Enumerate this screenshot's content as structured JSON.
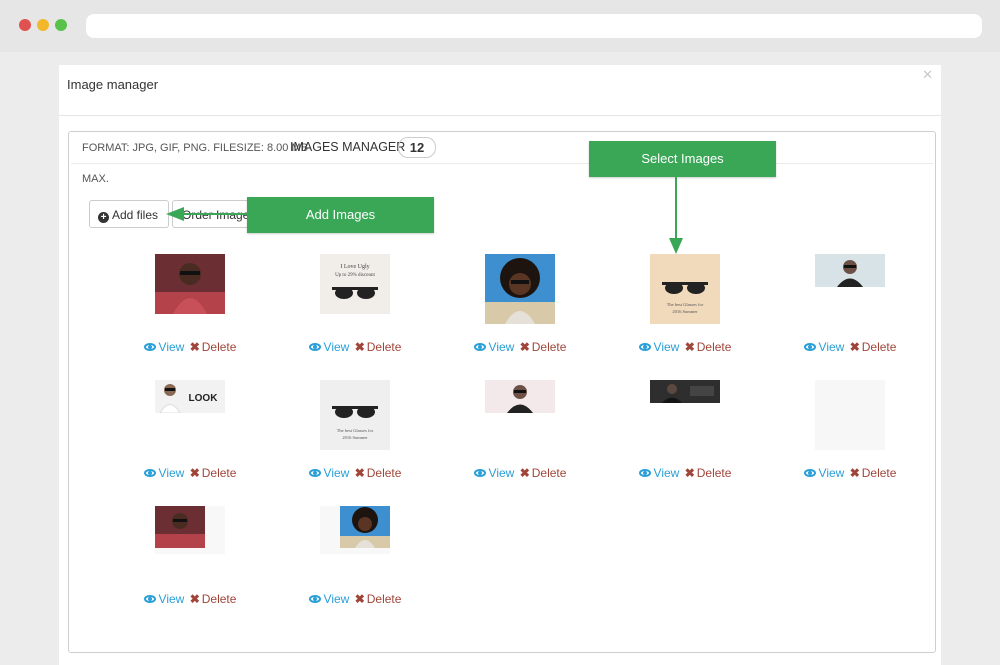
{
  "window": {
    "title": "Image manager"
  },
  "panel": {
    "format_text": "FORMAT: JPG, GIF, PNG. FILESIZE: 8.00 MB",
    "max_text": "MAX.",
    "manager_label": "IMAGES MANAGER",
    "image_count": "12"
  },
  "toolbar": {
    "add_files_label": "Add files",
    "order_images_label": "Order Images"
  },
  "actions": {
    "view_label": "View",
    "delete_label": "Delete"
  },
  "callouts": {
    "select_images": "Select Images",
    "add_images": "Add Images"
  },
  "colors": {
    "accent_green": "#3aa757",
    "link_blue": "#2a9fd8",
    "delete_red": "#a0453a"
  },
  "images": [
    {
      "subject": "man-sunglasses-red-shirt"
    },
    {
      "subject": "sunglasses-ad",
      "caption_lines": [
        "I Love Ugly",
        "Up to 29% discount"
      ]
    },
    {
      "subject": "woman-curly-hair-sunglasses"
    },
    {
      "subject": "sunglasses-ad-tan",
      "caption_lines": [
        "The best Glasses for",
        "2016 Summer"
      ]
    },
    {
      "subject": "man-glasses-banner"
    },
    {
      "subject": "look-banner",
      "caption_lines": [
        "LOOK"
      ]
    },
    {
      "subject": "sunglasses-ad-gray",
      "caption_lines": [
        "The best Glasses for",
        "2016 Summer"
      ]
    },
    {
      "subject": "glasses-banner-man"
    },
    {
      "subject": "dark-banner"
    },
    {
      "subject": "blank-placeholder"
    },
    {
      "subject": "man-sunglasses-red-shirt-small"
    },
    {
      "subject": "woman-curly-hair-small"
    }
  ]
}
